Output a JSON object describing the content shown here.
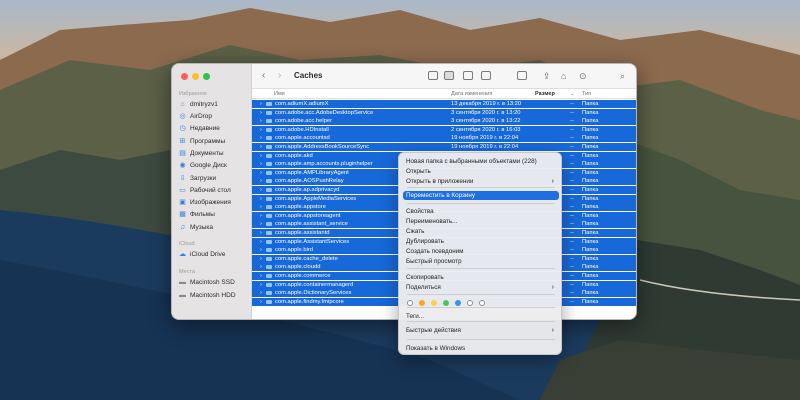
{
  "colors": {
    "selection": "#1769d9",
    "menu_highlight": "#1f6fe0",
    "traffic_close": "#fe5f57",
    "traffic_min": "#febc2e",
    "traffic_max": "#28c840"
  },
  "sidebar": {
    "favorites_label": "Избранное",
    "favorites": [
      {
        "label": "dmitryzv1",
        "icon": "home-icon"
      },
      {
        "label": "AirDrop",
        "icon": "airdrop-icon"
      },
      {
        "label": "Недавние",
        "icon": "clock-icon"
      },
      {
        "label": "Программы",
        "icon": "apps-icon"
      },
      {
        "label": "Документы",
        "icon": "document-icon"
      },
      {
        "label": "Google Диск",
        "icon": "cloud-drive-icon"
      },
      {
        "label": "Загрузки",
        "icon": "download-icon"
      },
      {
        "label": "Рабочий стол",
        "icon": "desktop-icon"
      },
      {
        "label": "Изображения",
        "icon": "image-icon"
      },
      {
        "label": "Фильмы",
        "icon": "film-icon"
      },
      {
        "label": "Музыка",
        "icon": "music-icon"
      }
    ],
    "icloud_label": "iCloud",
    "icloud": [
      {
        "label": "iCloud Drive",
        "icon": "icloud-icon"
      }
    ],
    "locations_label": "Места",
    "locations": [
      {
        "label": "Macintosh SSD",
        "icon": "disk-icon"
      },
      {
        "label": "Macintosh HDD",
        "icon": "disk-icon"
      }
    ]
  },
  "toolbar": {
    "back": "‹",
    "forward": "›",
    "title": "Caches"
  },
  "columns": {
    "name": "Имя",
    "date": "Дата изменения",
    "size": "Размер",
    "type": "Тип"
  },
  "rows": [
    {
      "name": "com.adiumX.adiumX",
      "date": "13 декабря 2019 г. в 13:20",
      "size": "--",
      "type": "Папка"
    },
    {
      "name": "com.adobe.acc.AdobeDesktopService",
      "date": "3 сентября 2020 г. в 13:20",
      "size": "--",
      "type": "Папка"
    },
    {
      "name": "com.adobe.acc.helper",
      "date": "3 сентября 2020 г. в 13:22",
      "size": "--",
      "type": "Папка"
    },
    {
      "name": "com.adobe.HDInstall",
      "date": "2 сентября 2020 г. в 16:03",
      "size": "--",
      "type": "Папка"
    },
    {
      "name": "com.apple.accountsd",
      "date": "19 ноября 2019 г. в 22:04",
      "size": "--",
      "type": "Папка"
    },
    {
      "name": "com.apple.AddressBookSourceSync",
      "date": "19 ноября 2019 г. в 22:04",
      "size": "--",
      "type": "Папка"
    },
    {
      "name": "com.apple.akd",
      "date": "",
      "size": "--",
      "type": "Папка"
    },
    {
      "name": "com.apple.amp.accounts.pluginhelper",
      "date": "",
      "size": "--",
      "type": "Папка"
    },
    {
      "name": "com.apple.AMPLibraryAgent",
      "date": "",
      "size": "--",
      "type": "Папка"
    },
    {
      "name": "com.apple.AOSPushRelay",
      "date": "",
      "size": "--",
      "type": "Папка"
    },
    {
      "name": "com.apple.ap.adprivacyd",
      "date": "",
      "size": "--",
      "type": "Папка"
    },
    {
      "name": "com.apple.AppleMediaServices",
      "date": "",
      "size": "--",
      "type": "Папка"
    },
    {
      "name": "com.apple.appstore",
      "date": "",
      "size": "--",
      "type": "Папка"
    },
    {
      "name": "com.apple.appstoreagent",
      "date": "",
      "size": "--",
      "type": "Папка"
    },
    {
      "name": "com.apple.assistant_service",
      "date": "",
      "size": "--",
      "type": "Папка"
    },
    {
      "name": "com.apple.assistantd",
      "date": "",
      "size": "--",
      "type": "Папка"
    },
    {
      "name": "com.apple.AssistantServices",
      "date": "",
      "size": "--",
      "type": "Папка"
    },
    {
      "name": "com.apple.bird",
      "date": "",
      "size": "--",
      "type": "Папка"
    },
    {
      "name": "com.apple.cache_delete",
      "date": "",
      "size": "--",
      "type": "Папка"
    },
    {
      "name": "com.apple.cloudd",
      "date": "",
      "size": "--",
      "type": "Папка"
    },
    {
      "name": "com.apple.commerce",
      "date": "",
      "size": "--",
      "type": "Папка"
    },
    {
      "name": "com.apple.containermanagerd",
      "date": "",
      "size": "--",
      "type": "Папка"
    },
    {
      "name": "com.apple.DictionaryServices",
      "date": "",
      "size": "--",
      "type": "Папка"
    },
    {
      "name": "com.apple.findmy.fmipcore",
      "date": "",
      "size": "--",
      "type": "Папка"
    }
  ],
  "context_menu": {
    "items": [
      {
        "label": "Новая папка с выбранными объектами (228)",
        "submenu": false,
        "highlighted": false
      },
      {
        "label": "Открыть",
        "submenu": false,
        "highlighted": false
      },
      {
        "label": "Открыть в приложении",
        "submenu": true,
        "highlighted": false
      },
      {
        "label": "Переместить в Корзину",
        "submenu": false,
        "highlighted": true
      },
      {
        "label": "Свойства",
        "submenu": false,
        "highlighted": false
      },
      {
        "label": "Переименовать...",
        "submenu": false,
        "highlighted": false
      },
      {
        "label": "Сжать",
        "submenu": false,
        "highlighted": false
      },
      {
        "label": "Дублировать",
        "submenu": false,
        "highlighted": false
      },
      {
        "label": "Создать псевдоним",
        "submenu": false,
        "highlighted": false
      },
      {
        "label": "Быстрый просмотр",
        "submenu": false,
        "highlighted": false
      },
      {
        "label": "Скопировать",
        "submenu": false,
        "highlighted": false
      },
      {
        "label": "Поделиться",
        "submenu": true,
        "highlighted": false
      },
      {
        "label": "Теги...",
        "submenu": false,
        "highlighted": false
      },
      {
        "label": "Быстрые действия",
        "submenu": true,
        "highlighted": false
      },
      {
        "label": "Показать в Windows",
        "submenu": false,
        "highlighted": false
      }
    ],
    "tag_colors": [
      "#ffffff",
      "#f5a623",
      "#f7d24a",
      "#4cc45a",
      "#3d8ef0",
      "#ffffff",
      "#ffffff"
    ]
  }
}
